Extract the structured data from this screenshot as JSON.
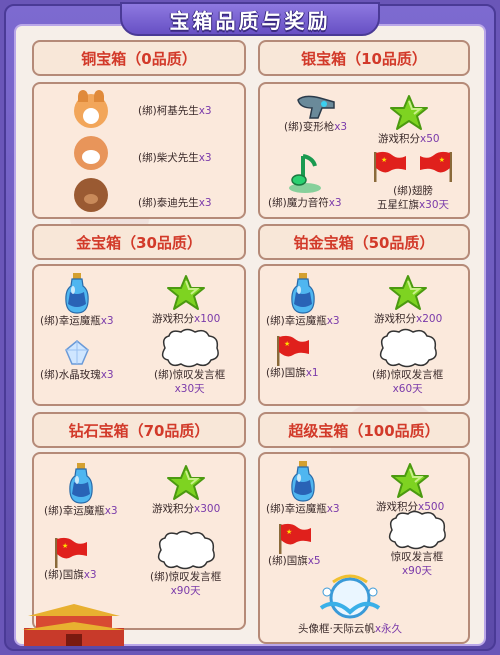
{
  "title": "宝箱品质与奖励",
  "colors": {
    "frame": "#6a56b8",
    "header_text": "#d23a2a",
    "count_text": "#7a3aaa"
  },
  "chests": [
    {
      "name": "铜宝箱（0品质）",
      "items": [
        {
          "label": "(绑)柯基先生",
          "count": "x3",
          "icon": "corgi-icon"
        },
        {
          "label": "(绑)柴犬先生",
          "count": "x3",
          "icon": "shiba-icon"
        },
        {
          "label": "(绑)泰迪先生",
          "count": "x3",
          "icon": "teddy-dog-icon"
        }
      ]
    },
    {
      "name": "银宝箱（10品质）",
      "items": [
        {
          "label": "(绑)变形枪",
          "count": "x3",
          "icon": "transform-gun-icon"
        },
        {
          "label": "游戏积分",
          "count": "x50",
          "icon": "green-star-icon"
        },
        {
          "label": "(绑)魔力音符",
          "count": "x3",
          "icon": "magic-note-icon"
        },
        {
          "label": "(绑)翅膀",
          "label2": "五星红旗",
          "count": "x30天",
          "icon": "flag-wings-icon"
        }
      ]
    },
    {
      "name": "金宝箱（30品质）",
      "items": [
        {
          "label": "(绑)幸运魔瓶",
          "count": "x3",
          "icon": "lucky-bottle-icon"
        },
        {
          "label": "游戏积分",
          "count": "x100",
          "icon": "green-star-icon"
        },
        {
          "label": "(绑)水晶玫瑰",
          "count": "x3",
          "icon": "crystal-rose-icon"
        },
        {
          "label": "(绑)惊叹发言框",
          "count": "x30天",
          "icon": "speech-bubble-icon"
        }
      ]
    },
    {
      "name": "铂金宝箱（50品质）",
      "items": [
        {
          "label": "(绑)幸运魔瓶",
          "count": "x3",
          "icon": "lucky-bottle-icon"
        },
        {
          "label": "游戏积分",
          "count": "x200",
          "icon": "green-star-icon"
        },
        {
          "label": "(绑)国旗",
          "count": "x1",
          "icon": "flag-icon"
        },
        {
          "label": "(绑)惊叹发言框",
          "count": "x60天",
          "icon": "speech-bubble-icon"
        }
      ]
    },
    {
      "name": "钻石宝箱（70品质）",
      "items": [
        {
          "label": "(绑)幸运魔瓶",
          "count": "x3",
          "icon": "lucky-bottle-icon"
        },
        {
          "label": "游戏积分",
          "count": "x300",
          "icon": "green-star-icon"
        },
        {
          "label": "(绑)国旗",
          "count": "x3",
          "icon": "flag-icon"
        },
        {
          "label": "(绑)惊叹发言框",
          "count": "x90天",
          "icon": "speech-bubble-icon"
        }
      ]
    },
    {
      "name": "超级宝箱（100品质）",
      "items": [
        {
          "label": "(绑)幸运魔瓶",
          "count": "x3",
          "icon": "lucky-bottle-icon"
        },
        {
          "label": "游戏积分",
          "count": "x500",
          "icon": "green-star-icon"
        },
        {
          "label": "(绑)国旗",
          "count": "x5",
          "icon": "flag-icon"
        },
        {
          "label": "惊叹发言框",
          "count": "x90天",
          "icon": "speech-bubble-icon"
        },
        {
          "label": "头像框·天际云帆",
          "count": "x永久",
          "icon": "avatar-frame-icon"
        }
      ]
    }
  ]
}
